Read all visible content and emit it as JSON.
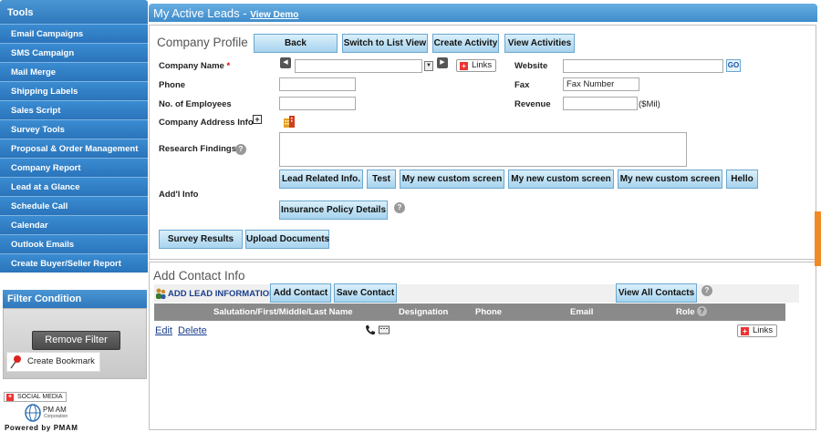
{
  "sidebar": {
    "title": "Tools",
    "items": [
      {
        "label": "Email Campaigns"
      },
      {
        "label": "SMS Campaign"
      },
      {
        "label": "Mail Merge"
      },
      {
        "label": "Shipping Labels"
      },
      {
        "label": "Sales Script"
      },
      {
        "label": "Survey Tools"
      },
      {
        "label": "Proposal & Order Management"
      },
      {
        "label": "Company Report"
      },
      {
        "label": "Lead at a Glance"
      },
      {
        "label": "Schedule Call"
      },
      {
        "label": "Calendar"
      },
      {
        "label": "Outlook Emails"
      },
      {
        "label": "Create Buyer/Seller Report"
      }
    ],
    "filter_title": "Filter Condition",
    "remove_filter_label": "Remove Filter",
    "bookmark_label": "Create Bookmark",
    "social_label": "SOCIAL MEDIA",
    "logo_text": "PM AM",
    "logo_corp": "Corporation",
    "powered_by": "Powered by PMAM"
  },
  "header": {
    "title": "My Active Leads - ",
    "demo_link": "View Demo"
  },
  "profile": {
    "title": "Company Profile",
    "buttons": {
      "back": "Back",
      "list_view": "Switch to List View",
      "create_activity": "Create Activity",
      "view_activities": "View Activities"
    },
    "fields": {
      "company_name": {
        "label": "Company Name",
        "required": "*",
        "value": ""
      },
      "phone": {
        "label": "Phone",
        "value": ""
      },
      "employees": {
        "label": "No. of Employees",
        "value": ""
      },
      "address": {
        "label": "Company Address Info"
      },
      "research": {
        "label": "Research Findings",
        "value": ""
      },
      "website": {
        "label": "Website",
        "value": ""
      },
      "fax": {
        "label": "Fax",
        "value": "Fax Number"
      },
      "revenue": {
        "label": "Revenue",
        "value": "",
        "unit": "($Mil)"
      },
      "addl": {
        "label": "Add'l Info"
      }
    },
    "links_label": "Links",
    "go_label": "GO",
    "custom_buttons": [
      "Lead Related Info.",
      "Test",
      "My new custom screen",
      "My new custom screen",
      "My new custom screen",
      "Hello"
    ],
    "insurance_label": "Insurance Policy Details",
    "survey_label": "Survey Results",
    "upload_label": "Upload Documents"
  },
  "contacts": {
    "title": "Add Contact Info",
    "add_lead_info": "ADD LEAD INFORMATION",
    "add_contact": "Add Contact",
    "save_contact": "Save Contact",
    "view_all": "View All Contacts",
    "columns": [
      "Salutation/First/Middle/Last Name",
      "Designation",
      "Phone",
      "Email",
      "Role"
    ],
    "row": {
      "edit": "Edit",
      "delete": "Delete",
      "links": "Links"
    }
  },
  "colors": {
    "sidebar_blue": "#2f78bc",
    "header_blue": "#4f9ad6",
    "button_blue": "#a7d3ee",
    "accent_orange": "#f08a24",
    "required_red": "#dd0000"
  }
}
